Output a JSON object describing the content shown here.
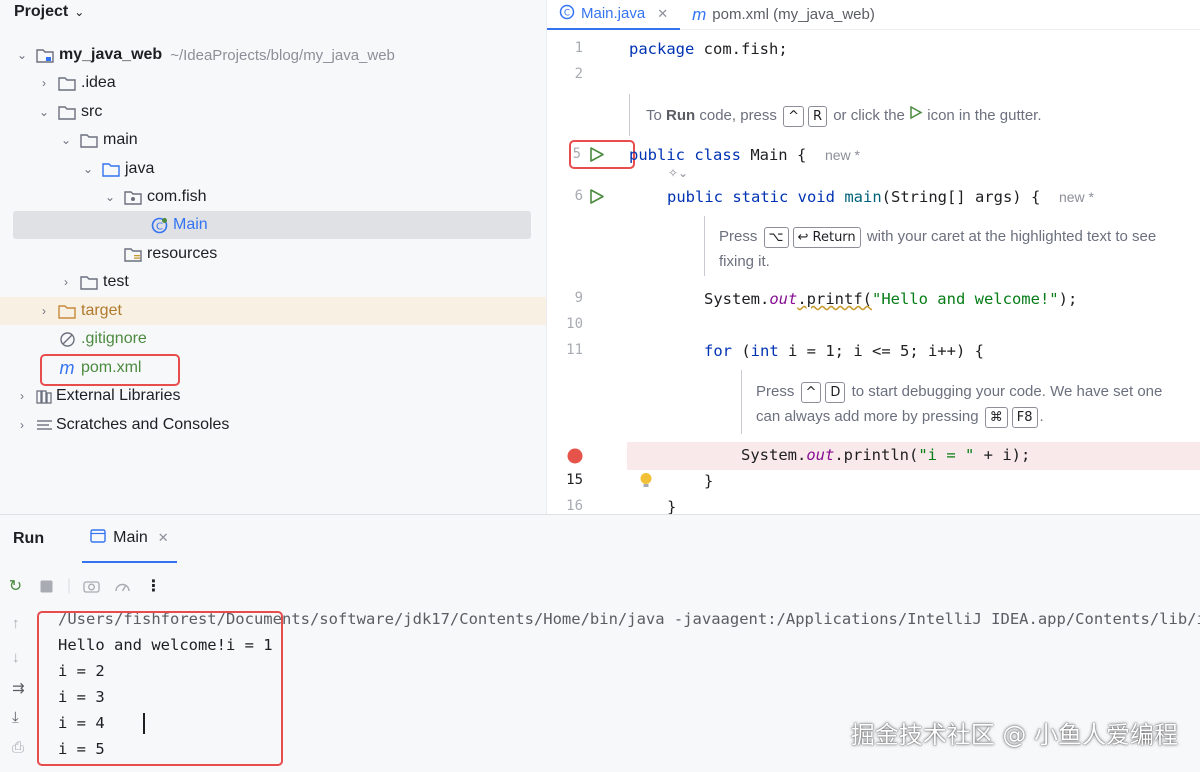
{
  "project": {
    "title": "Project",
    "root_name": "my_java_web",
    "root_path": "~/IdeaProjects/blog/my_java_web",
    "items": [
      {
        "label": ".idea"
      },
      {
        "label": "src"
      },
      {
        "label": "main"
      },
      {
        "label": "java"
      },
      {
        "label": "com.fish"
      },
      {
        "label": "Main"
      },
      {
        "label": "resources"
      },
      {
        "label": "test"
      },
      {
        "label": "target"
      },
      {
        "label": ".gitignore"
      },
      {
        "label": "pom.xml"
      },
      {
        "label": "External Libraries"
      },
      {
        "label": "Scratches and Consoles"
      }
    ]
  },
  "editor": {
    "tabs": [
      {
        "label": "Main.java"
      },
      {
        "label": "pom.xml (my_java_web)"
      }
    ],
    "line_numbers": [
      "1",
      "2",
      "5",
      "6",
      "9",
      "10",
      "11",
      "15",
      "16"
    ],
    "code": {
      "l1_kw": "package",
      "l1_rest": " com.fish;",
      "l5_kw": "public class",
      "l5_rest": " Main {",
      "new_hint": "new *",
      "l6_kw": "public static void",
      "l6_fn": "main",
      "l6_rest": "(String[] args) {",
      "l9_a": "System.",
      "l9_fld": "out",
      "l9_b": ".printf(",
      "l9_str": "\"Hello and welcome!\"",
      "l9_c": ");",
      "l11_kw1": "for",
      "l11_a": " (",
      "l11_kw2": "int",
      "l11_b": " i = 1; i <= 5; i++) {",
      "l14_a": "System.",
      "l14_fld": "out",
      "l14_b": ".println(",
      "l14_str": "\"i = \"",
      "l14_c": " + i);",
      "l15": "}",
      "l16": "}"
    },
    "tips": {
      "t1_a": "To",
      "t1_run": "Run",
      "t1_b": "code, press",
      "t1_key1": "^",
      "t1_key2": "R",
      "t1_c": "or click the",
      "t1_d": "icon in the gutter.",
      "t2_a": "Press",
      "t2_key1": "⌥",
      "t2_key2": "↩ Return",
      "t2_b": "with your caret at the highlighted text to see",
      "t2_c": "fixing it.",
      "t3_a": "Press",
      "t3_key1": "^",
      "t3_key2": "D",
      "t3_b": "to start debugging your code. We have set one",
      "t3_c": "can always add more by pressing",
      "t3_key3": "⌘",
      "t3_key4": "F8",
      "t3_d": "."
    }
  },
  "run": {
    "title": "Run",
    "tab": "Main",
    "console": [
      "/Users/fishforest/Documents/software/jdk17/Contents/Home/bin/java -javaagent:/Applications/IntelliJ IDEA.app/Contents/lib/ide",
      "Hello and welcome!i = 1",
      "i = 2",
      "i = 3",
      "i = 4",
      "i = 5"
    ]
  },
  "watermark": "掘金技术社区 @ 小鱼人爱编程",
  "colors": {
    "accent": "#3574f0",
    "highlight_box": "#e74d4d",
    "run_green": "#4c8a3f",
    "breakpoint": "#e5534b"
  }
}
